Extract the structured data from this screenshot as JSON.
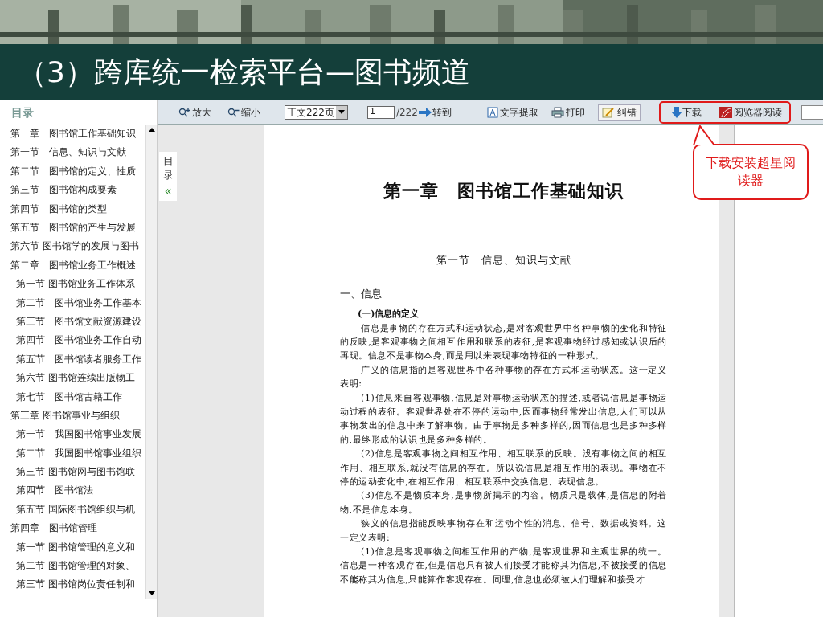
{
  "slide": {
    "title": "（3）跨库统一检索平台—图书频道"
  },
  "toolbar": {
    "zoom_in": "放大",
    "zoom_out": "缩小",
    "page_select": "正文222页",
    "page_input": "1",
    "page_total": "/222",
    "goto": "转到",
    "extract_text": "文字提取",
    "print": "打印",
    "correct": "纠错",
    "download": "下载",
    "reader": "阅览器阅读"
  },
  "callout": "下载安装超星阅读器",
  "side_tab": {
    "label": "目录",
    "collapse": "«"
  },
  "toc": {
    "title": "目录",
    "items": [
      {
        "label": "第一章　图书馆工作基础知识",
        "indented": false
      },
      {
        "label": "第一节　信息、知识与文献",
        "indented": false
      },
      {
        "label": "第二节　图书馆的定义、性质",
        "indented": false
      },
      {
        "label": "第三节　图书馆构成要素",
        "indented": false
      },
      {
        "label": "第四节　图书馆的类型",
        "indented": false
      },
      {
        "label": "第五节　图书馆的产生与发展",
        "indented": false
      },
      {
        "label": "第六节 图书馆学的发展与图书",
        "indented": false
      },
      {
        "label": "第二章　图书馆业务工作概述",
        "indented": false
      },
      {
        "label": "第一节 图书馆业务工作体系",
        "indented": true
      },
      {
        "label": "第二节　图书馆业务工作基本",
        "indented": true
      },
      {
        "label": "第三节　图书馆文献资源建设",
        "indented": true
      },
      {
        "label": "第四节　图书馆业务工作自动",
        "indented": true
      },
      {
        "label": "第五节　图书馆读者服务工作",
        "indented": true
      },
      {
        "label": "第六节 图书馆连续出版物工",
        "indented": true
      },
      {
        "label": "第七节　图书馆古籍工作",
        "indented": true
      },
      {
        "label": "第三章 图书馆事业与组织",
        "indented": false
      },
      {
        "label": "第一节　我国图书馆事业发展",
        "indented": true
      },
      {
        "label": "第二节　我国图书馆事业组织",
        "indented": true
      },
      {
        "label": "第三节 图书馆网与图书馆联",
        "indented": true
      },
      {
        "label": "第四节　图书馆法",
        "indented": true
      },
      {
        "label": "第五节 国际图书馆组织与机",
        "indented": true
      },
      {
        "label": "第四章　图书馆管理",
        "indented": false
      },
      {
        "label": "第一节 图书馆管理的意义和",
        "indented": true
      },
      {
        "label": "第二节 图书馆管理的对象、",
        "indented": true
      },
      {
        "label": "第三节 图书馆岗位责任制和",
        "indented": true
      }
    ]
  },
  "document": {
    "chapter_title": "第一章　图书馆工作基础知识",
    "section_title": "第一节　信息、知识与文献",
    "heading": "一、信息",
    "subheading": "(一)信息的定义",
    "paragraphs": [
      "信息是事物的存在方式和运动状态,是对客观世界中各种事物的变化和特征的反映,是客观事物之间相互作用和联系的表征,是客观事物经过感知或认识后的再现。信息不是事物本身,而是用以来表现事物特征的一种形式。",
      "广义的信息指的是客观世界中各种事物的存在方式和运动状态。这一定义表明:",
      "(1)信息来自客观事物,信息是对事物运动状态的描述,或者说信息是事物运动过程的表征。客观世界处在不停的运动中,因而事物经常发出信息,人们可以从事物发出的信息中来了解事物。由于事物是多种多样的,因而信息也是多种多样的,最终形成的认识也是多种多样的。",
      "(2)信息是客观事物之间相互作用、相互联系的反映。没有事物之间的相互作用、相互联系,就没有信息的存在。所以说信息是相互作用的表现。事物在不停的运动变化中,在相互作用、相互联系中交换信息、表现信息。",
      "(3)信息不是物质本身,是事物所揭示的内容。物质只是载体,是信息的附着物,不是信息本身。",
      "狭义的信息指能反映事物存在和运动个性的消息、信号、数据或资料。这一定义表明:",
      "(1)信息是客观事物之间相互作用的产物,是客观世界和主观世界的统一。信息是一种客观存在,但是信息只有被人们接受才能称其为信息,不被接受的信息不能称其为信息,只能算作客观存在。同理,信息也必须被人们理解和接受才"
    ]
  }
}
